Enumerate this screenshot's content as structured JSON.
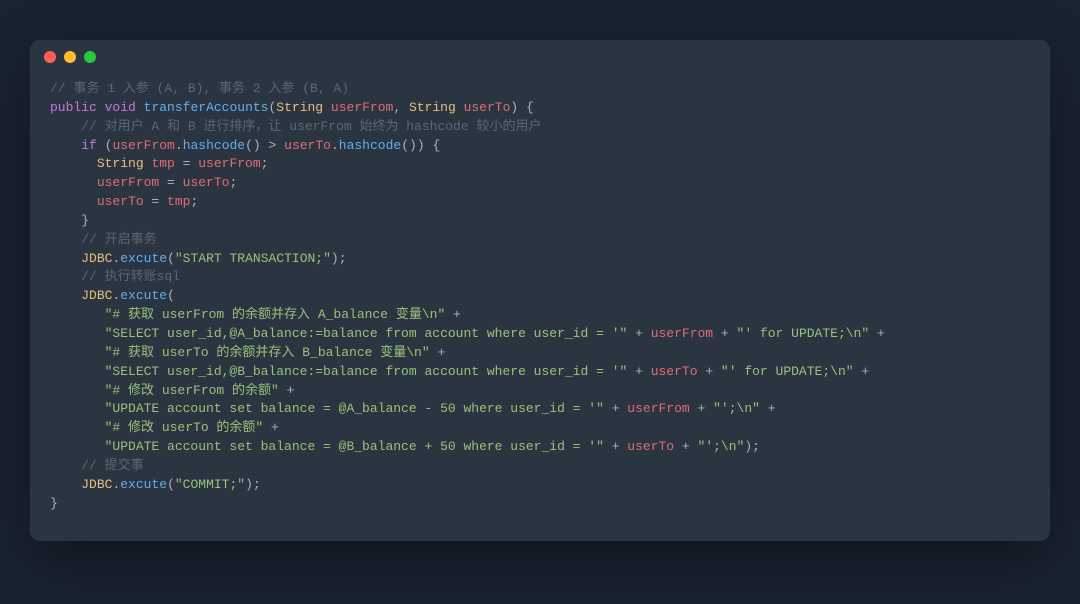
{
  "comments": {
    "c1": "// 事务 1 入参 (A, B), 事务 2 入参 (B, A)",
    "c2": "// 对用户 A 和 B 进行排序，让 userFrom 始终为 hashcode 较小的用户",
    "c3": "// 开启事务",
    "c4": "// 执行转账sql",
    "c5": "// 提交事"
  },
  "kw": {
    "public": "public",
    "void": "void",
    "if": "if",
    "String": "String"
  },
  "fn": {
    "transferAccounts": "transferAccounts",
    "hashcode": "hashcode",
    "excute": "excute"
  },
  "var": {
    "userFrom": "userFrom",
    "userTo": "userTo",
    "tmp": "tmp",
    "JDBC": "JDBC"
  },
  "str": {
    "startTx": "\"START TRANSACTION;\"",
    "s1": "\"# 获取 userFrom 的余额并存入 A_balance 变量\\n\"",
    "s2a": "\"SELECT user_id,@A_balance:=balance from account where user_id = '\"",
    "s2b": "\"' for UPDATE;\\n\"",
    "s3": "\"# 获取 userTo 的余额并存入 B_balance 变量\\n\"",
    "s4a": "\"SELECT user_id,@B_balance:=balance from account where user_id = '\"",
    "s4b": "\"' for UPDATE;\\n\"",
    "s5": "\"# 修改 userFrom 的余额\"",
    "s6a": "\"UPDATE account set balance = @A_balance - 50 where user_id = '\"",
    "s6b": "\"';\\n\"",
    "s7": "\"# 修改 userTo 的余额\"",
    "s8a": "\"UPDATE account set balance = @B_balance + 50 where user_id = '\"",
    "s8b": "\"';\\n\"",
    "commit": "\"COMMIT;\""
  },
  "punct": {
    "openParen": "(",
    "closeParen": ")",
    "openBrace": "{",
    "closeBrace": "}",
    "comma": ", ",
    "dot": ".",
    "gt": " > ",
    "eq": " = ",
    "semi": ";",
    "plus": " + ",
    "closeParenSemi": ");"
  }
}
